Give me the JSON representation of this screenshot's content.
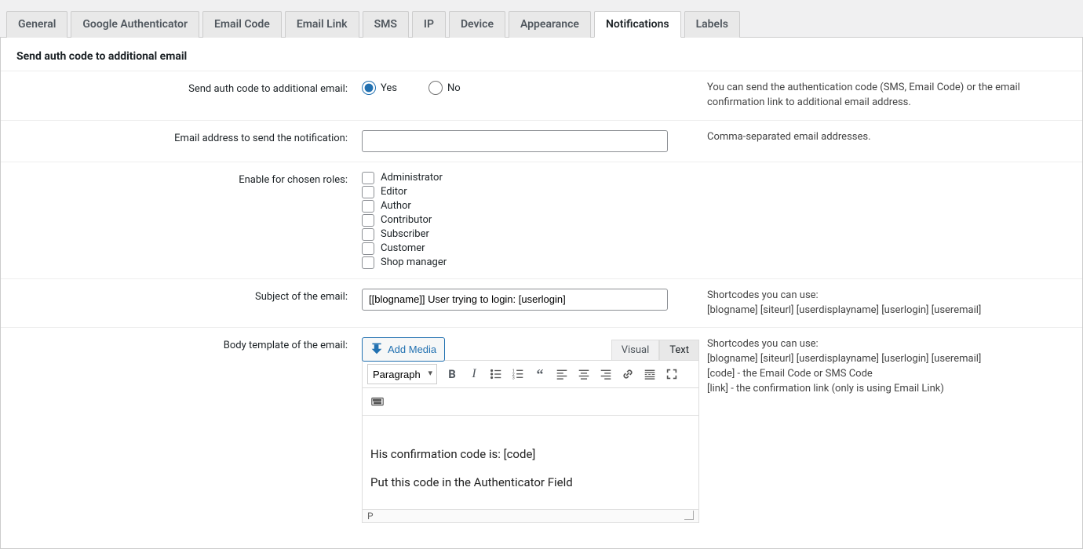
{
  "tabs": {
    "items": [
      {
        "label": "General"
      },
      {
        "label": "Google Authenticator"
      },
      {
        "label": "Email Code"
      },
      {
        "label": "Email Link"
      },
      {
        "label": "SMS"
      },
      {
        "label": "IP"
      },
      {
        "label": "Device"
      },
      {
        "label": "Appearance"
      },
      {
        "label": "Notifications"
      },
      {
        "label": "Labels"
      }
    ],
    "active_index": 8
  },
  "section": {
    "title": "Send auth code to additional email"
  },
  "rows": {
    "send_additional": {
      "label": "Send auth code to additional email:",
      "yes": "Yes",
      "no": "No",
      "selected": "yes",
      "help": "You can send the authentication code (SMS, Email Code) or the email confirmation link to additional email address."
    },
    "email_address": {
      "label": "Email address to send the notification:",
      "value": "",
      "help": "Comma-separated email addresses."
    },
    "roles": {
      "label": "Enable for chosen roles:",
      "items": [
        {
          "label": "Administrator",
          "checked": false
        },
        {
          "label": "Editor",
          "checked": false
        },
        {
          "label": "Author",
          "checked": false
        },
        {
          "label": "Contributor",
          "checked": false
        },
        {
          "label": "Subscriber",
          "checked": false
        },
        {
          "label": "Customer",
          "checked": false
        },
        {
          "label": "Shop manager",
          "checked": false
        }
      ]
    },
    "subject": {
      "label": "Subject of the email:",
      "value": "[[blogname]] User trying to login: [userlogin]",
      "help": "Shortcodes you can use:\n[blogname] [siteurl] [userdisplayname] [userlogin] [useremail]"
    },
    "body": {
      "label": "Body template of the email:",
      "add_media": "Add Media",
      "tab_visual": "Visual",
      "tab_text": "Text",
      "active_editor_tab": "text",
      "format_select": "Paragraph",
      "content_line1": "His confirmation code is: [code]",
      "content_line2": "Put this code in the Authenticator Field",
      "status_path": "P",
      "help": "Shortcodes you can use:\n[blogname] [siteurl] [userdisplayname] [userlogin] [useremail]\n[code] - the Email Code or SMS Code\n[link] - the confirmation link (only is using Email Link)"
    }
  }
}
